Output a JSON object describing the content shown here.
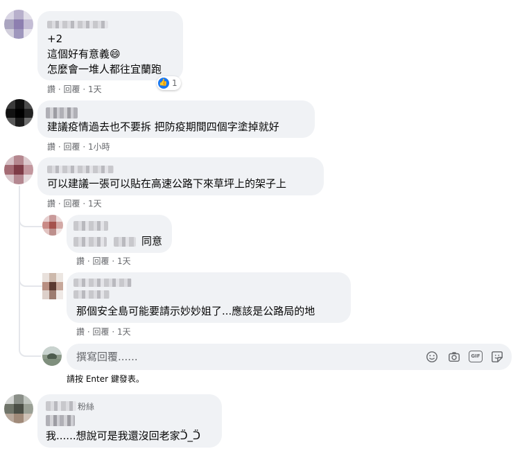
{
  "comments": [
    {
      "lines": [
        "+2",
        "這個好有意義😄",
        "怎麼會一堆人都往宜蘭跑"
      ],
      "actions": {
        "like": "讚",
        "reply": "回覆",
        "time": "1天"
      },
      "reaction_count": "1"
    },
    {
      "lines": [
        "建議疫情過去也不要拆 把防疫期間四個字塗掉就好"
      ],
      "actions": {
        "like": "讚",
        "reply": "回覆",
        "time": "1小時"
      }
    },
    {
      "lines": [
        "可以建議一張可以貼在高速公路下來草坪上的架子上"
      ],
      "actions": {
        "like": "讚",
        "reply": "回覆",
        "time": "1天"
      },
      "replies": [
        {
          "lines": [
            "同意"
          ],
          "actions": {
            "like": "讚",
            "reply": "回覆",
            "time": "1天"
          }
        },
        {
          "lines": [
            "那個安全島可能要請示妙妙姐了...應該是公路局的地"
          ],
          "actions": {
            "like": "讚",
            "reply": "回覆",
            "time": "1天"
          }
        }
      ]
    },
    {
      "name_suffix": "粉絲",
      "lines": [
        "我......想說可是我還沒回老家ᑒ_ᑒ"
      ]
    }
  ],
  "dot": "·",
  "composer": {
    "placeholder": "撰寫回覆......",
    "hint": "請按 Enter 鍵發表。",
    "icons": [
      "emoji-icon",
      "camera-icon",
      "gif-icon",
      "sticker-icon"
    ],
    "gif_label": "GIF"
  },
  "colors": {
    "bubble": "#f0f2f5",
    "meta": "#65676b",
    "like_blue": "#1877f2"
  }
}
